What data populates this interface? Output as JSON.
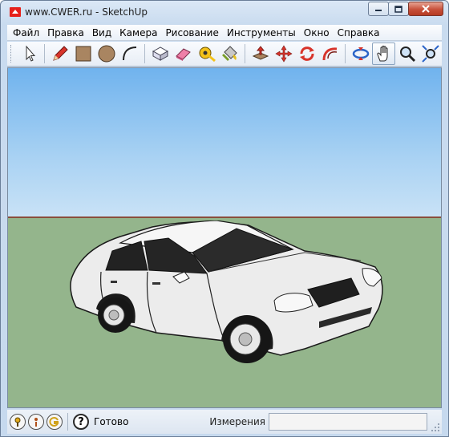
{
  "window": {
    "title": "www.CWER.ru - SketchUp",
    "minimize_icon": "minimize-icon",
    "maximize_icon": "maximize-icon",
    "close_icon": "close-icon"
  },
  "menubar": {
    "items": [
      "Файл",
      "Правка",
      "Вид",
      "Камера",
      "Рисование",
      "Инструменты",
      "Окно",
      "Справка"
    ]
  },
  "toolbar": {
    "tools": [
      "select-icon",
      "pencil-icon",
      "rectangle-icon",
      "circle-icon",
      "arc-icon",
      "make-component-icon",
      "eraser-icon",
      "tape-measure-icon",
      "paint-bucket-icon",
      "push-pull-icon",
      "move-icon",
      "rotate-icon",
      "follow-me-icon",
      "orbit-icon",
      "pan-icon",
      "zoom-icon",
      "zoom-extents-icon"
    ],
    "active_tool": "pan-icon"
  },
  "viewport": {
    "sky_color": "#8cc3f0",
    "ground_color": "#94b58c",
    "horizon_color": "#8a4e3c",
    "model": "car-model"
  },
  "statusbar": {
    "icons": [
      "geo-location-icon",
      "credits-icon",
      "google-sign-in-icon",
      "help-icon"
    ],
    "help_glyph": "?",
    "status_text": "Готово",
    "measurements_label": "Измерения",
    "measurements_value": ""
  }
}
